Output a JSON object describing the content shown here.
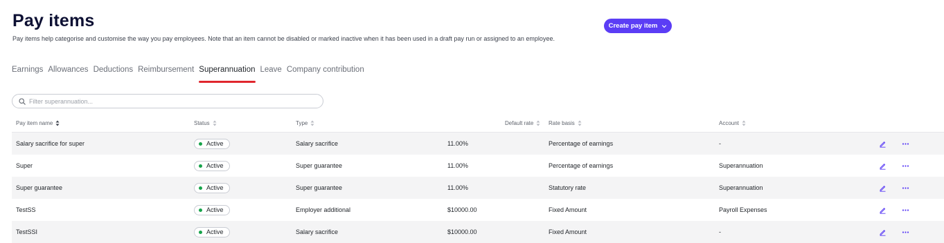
{
  "header": {
    "title": "Pay items",
    "subtitle": "Pay items help categorise and customise the way you pay employees. Note that an item cannot be disabled or marked inactive when it has been used in a draft pay run or assigned to an employee.",
    "create_button_label": "Create pay item",
    "accent_color": "#5b3df5"
  },
  "tabs": [
    {
      "label": "Earnings",
      "active": false
    },
    {
      "label": "Allowances",
      "active": false
    },
    {
      "label": "Deductions",
      "active": false
    },
    {
      "label": "Reimbursement",
      "active": false
    },
    {
      "label": "Superannuation",
      "active": true
    },
    {
      "label": "Leave",
      "active": false
    },
    {
      "label": "Company contribution",
      "active": false
    }
  ],
  "filter": {
    "placeholder": "Filter superannuation..."
  },
  "table": {
    "columns": {
      "name": "Pay item name",
      "status": "Status",
      "type": "Type",
      "default_rate": "Default rate",
      "rate_basis": "Rate basis",
      "account": "Account"
    },
    "rows": [
      {
        "name": "Salary sacrifice for super",
        "status": "Active",
        "type": "Salary sacrifice",
        "default_rate": "11.00%",
        "rate_basis": "Percentage of earnings",
        "account": "-"
      },
      {
        "name": "Super",
        "status": "Active",
        "type": "Super guarantee",
        "default_rate": "11.00%",
        "rate_basis": "Percentage of earnings",
        "account": "Superannuation"
      },
      {
        "name": "Super guarantee",
        "status": "Active",
        "type": "Super guarantee",
        "default_rate": "11.00%",
        "rate_basis": "Statutory rate",
        "account": "Superannuation"
      },
      {
        "name": "TestSS",
        "status": "Active",
        "type": "Employer additional",
        "default_rate": "$10000.00",
        "rate_basis": "Fixed Amount",
        "account": "Payroll Expenses"
      },
      {
        "name": "TestSSI",
        "status": "Active",
        "type": "Salary sacrifice",
        "default_rate": "$10000.00",
        "rate_basis": "Fixed Amount",
        "account": "-"
      }
    ],
    "status_color": "#16a34a",
    "row_icons": [
      "pencil-icon",
      "more-horizontal-icon"
    ]
  }
}
